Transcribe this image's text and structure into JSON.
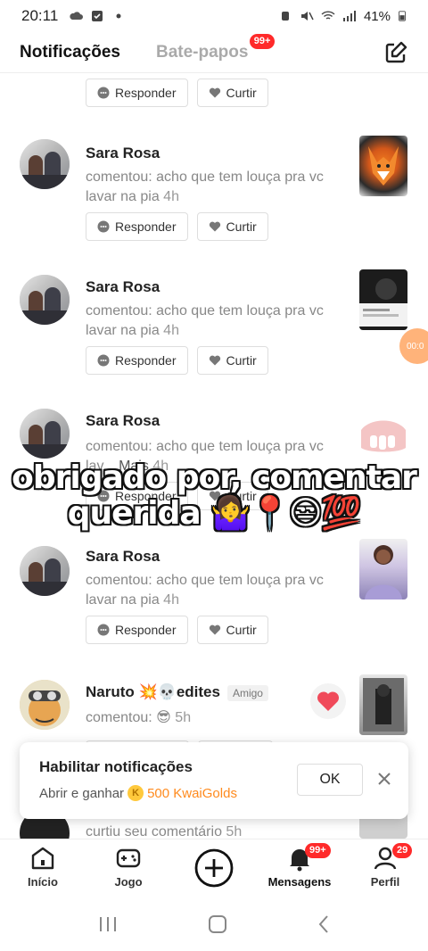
{
  "status_bar": {
    "time": "20:11",
    "battery": "41%"
  },
  "header": {
    "tab_active": "Notificações",
    "tab_inactive": "Bate-papos",
    "chat_badge": "99+"
  },
  "actions": {
    "reply": "Responder",
    "like": "Curtir"
  },
  "notifications": [
    {
      "name": "Sara Rosa",
      "comment": "comentou: acho que tem louça pra vc lavar na pia",
      "time": "4h"
    },
    {
      "name": "Sara Rosa",
      "comment": "comentou: acho que tem louça pra vc lavar na pia",
      "time": "4h"
    },
    {
      "name": "Sara Rosa",
      "comment": "comentou: acho que tem louça pra vc lav...",
      "more": "Mais",
      "time": "4h"
    },
    {
      "name": "Sara Rosa",
      "comment": "comentou: acho que tem louça pra vc lavar na pia",
      "time": "4h"
    },
    {
      "name": "Naruto 💥💀edites",
      "tag": "Amigo",
      "comment": "comentou: 😎",
      "time": "5h"
    },
    {
      "comment": "curtiu seu comentário",
      "time": "5h"
    }
  ],
  "caption": {
    "line1": "obrigado por, comentar",
    "line2": "querida 🤷‍♀️📍😒💯"
  },
  "floating_timer": "00:0",
  "toast": {
    "title": "Habilitar notificações",
    "subtitle": "Abrir e ganhar",
    "reward": "500 KwaiGolds",
    "ok": "OK"
  },
  "bottom_nav": {
    "home": "Início",
    "game": "Jogo",
    "messages": "Mensagens",
    "messages_badge": "99+",
    "profile": "Perfil",
    "profile_badge": "29"
  },
  "colors": {
    "accent": "#ff2a2a",
    "gold": "#ff8a1d"
  }
}
